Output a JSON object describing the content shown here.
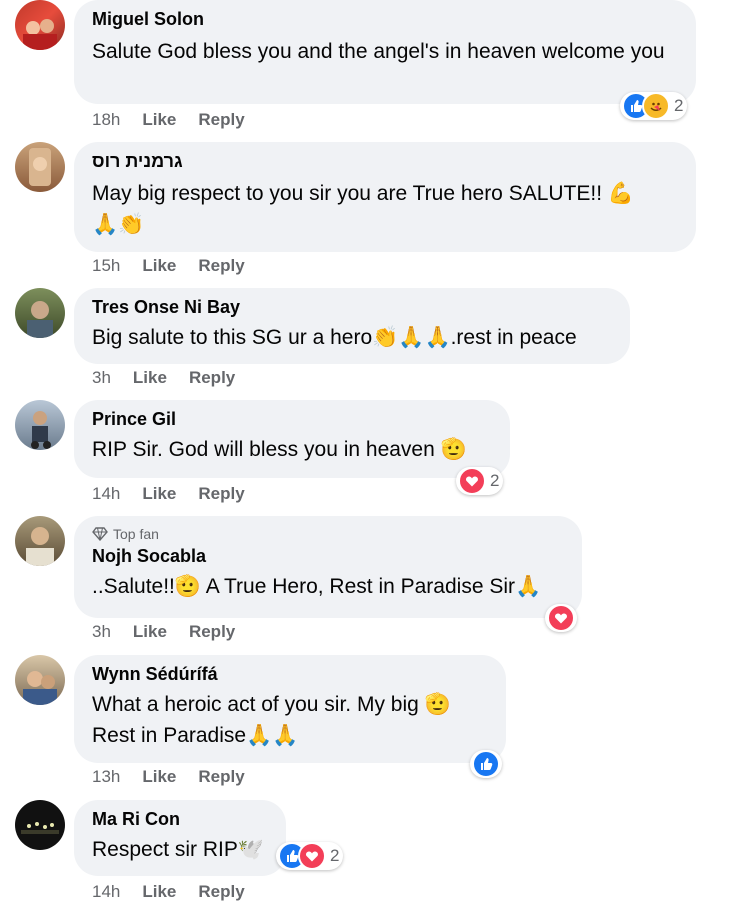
{
  "labels": {
    "like": "Like",
    "reply": "Reply"
  },
  "comments": [
    {
      "author": "Miguel Solon",
      "text": "Salute God bless you and the angel's in heaven welcome you",
      "time": "18h",
      "reaction_count": "2",
      "top_fan": ""
    },
    {
      "author": "גרמנית רוס",
      "text": "May big respect to you sir you are True hero SALUTE!! 💪 🙏👏",
      "time": "15h",
      "reaction_count": "",
      "top_fan": ""
    },
    {
      "author": "Tres Onse Ni Bay",
      "text": "Big salute to this SG ur a hero👏🙏🙏.rest in peace",
      "time": "3h",
      "reaction_count": "",
      "top_fan": ""
    },
    {
      "author": "Prince Gil",
      "text": "RIP Sir. God will bless you in heaven 🫡",
      "time": "14h",
      "reaction_count": "2",
      "top_fan": ""
    },
    {
      "author": "Nojh Socabla",
      "text": "..Salute!!🫡 A True Hero, Rest in Paradise Sir🙏",
      "time": "3h",
      "reaction_count": "",
      "top_fan": "Top fan"
    },
    {
      "author": "Wynn Sédúrífá",
      "text": "What a heroic act of you sir. My big 🫡 Rest in Paradise🙏🙏",
      "time": "13h",
      "reaction_count": "",
      "top_fan": ""
    },
    {
      "author": "Ma Ri Con",
      "text": "Respect sir RIP🕊️",
      "time": "14h",
      "reaction_count": "2",
      "top_fan": ""
    }
  ],
  "colors": {
    "bubble": "#f0f2f5",
    "meta": "#65676b",
    "like_blue": "#1877f2",
    "love_red": "#f33e58"
  }
}
